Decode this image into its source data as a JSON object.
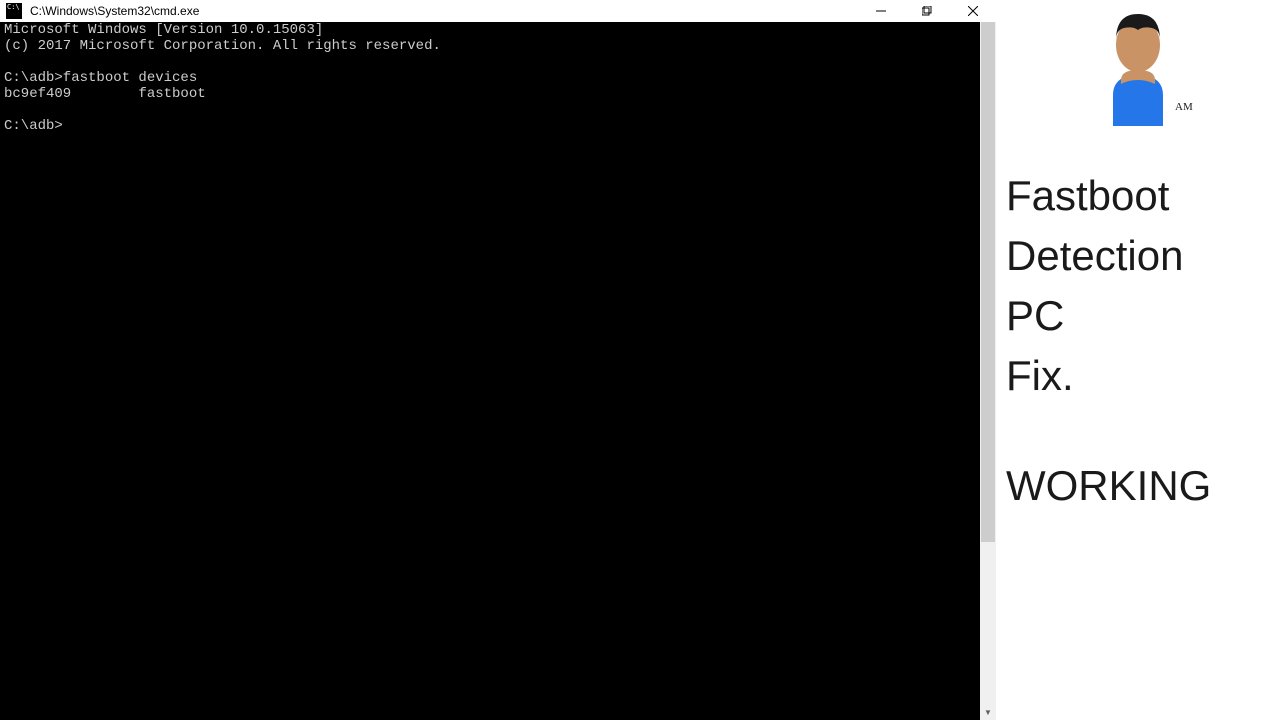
{
  "window": {
    "title": "C:\\Windows\\System32\\cmd.exe"
  },
  "terminal": {
    "lines": [
      "Microsoft Windows [Version 10.0.15063]",
      "(c) 2017 Microsoft Corporation. All rights reserved.",
      "",
      "C:\\adb>fastboot devices",
      "bc9ef409        fastboot",
      "",
      "C:\\adb>"
    ]
  },
  "side": {
    "avatar_label": "AM",
    "line1": "Fastboot",
    "line2": "Detection",
    "line3": "PC",
    "line4": "Fix.",
    "line5": "WORKING"
  }
}
